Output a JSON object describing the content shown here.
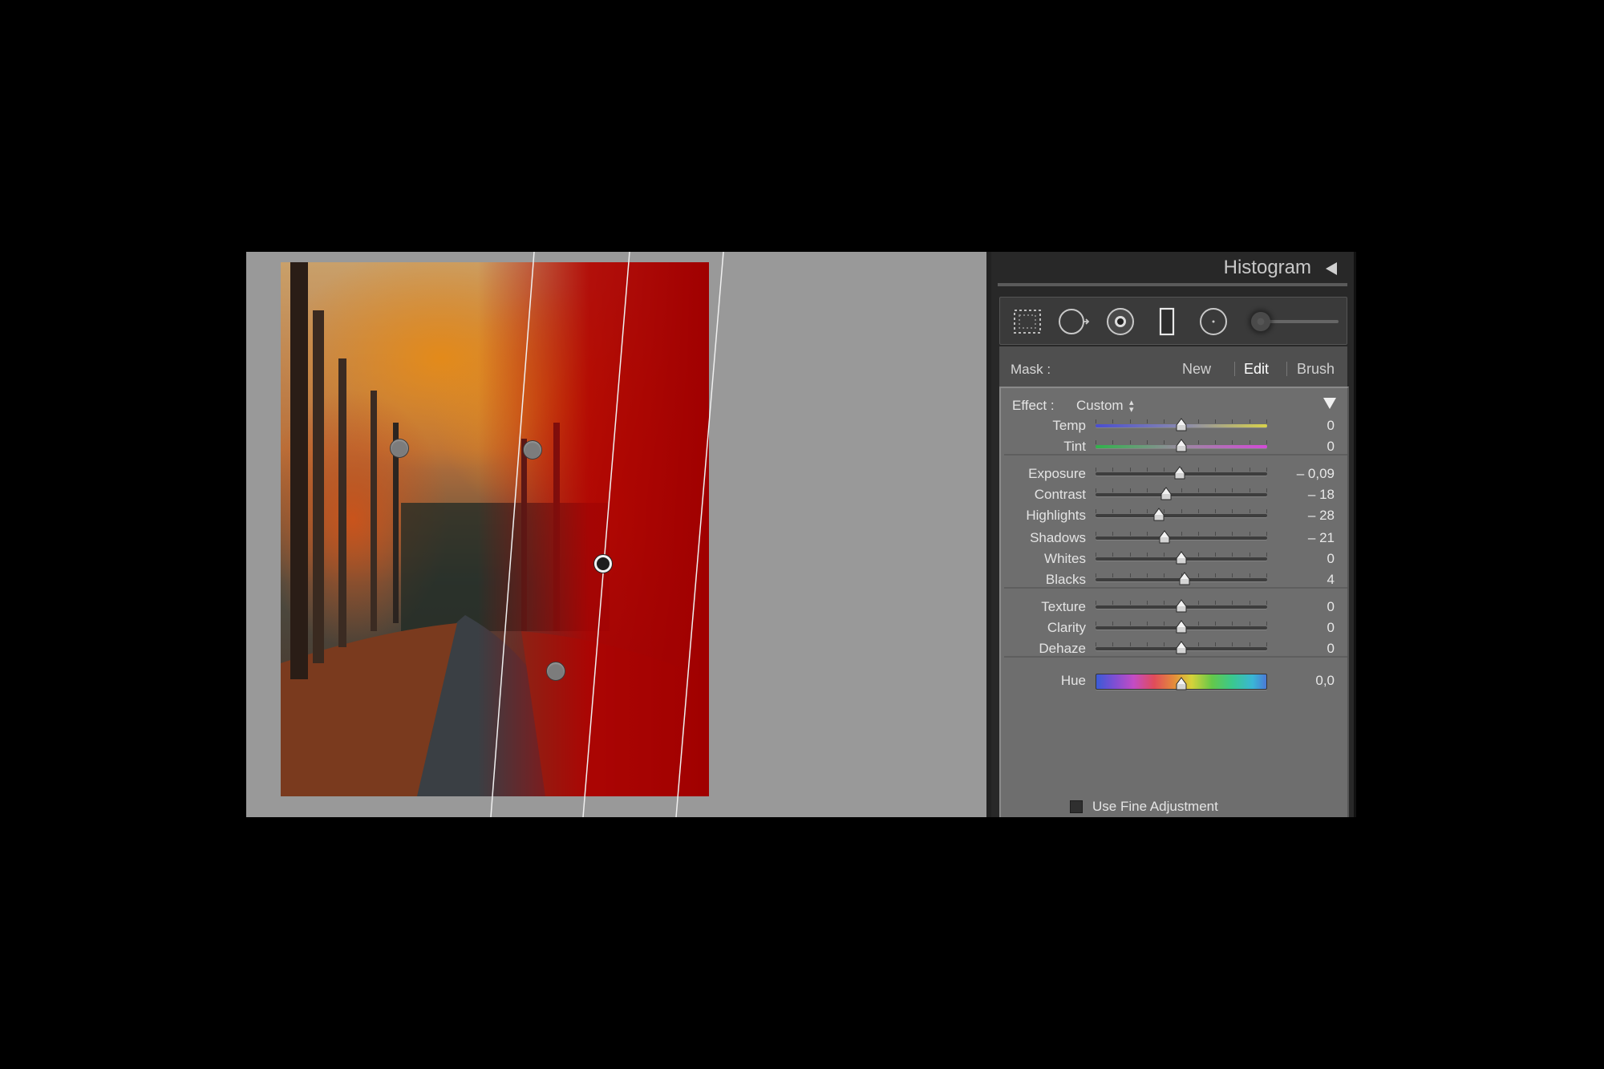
{
  "histogram": {
    "title": "Histogram"
  },
  "tools": [
    {
      "name": "range-mask-tool-icon"
    },
    {
      "name": "spot-removal-tool-icon"
    },
    {
      "name": "red-eye-tool-icon"
    },
    {
      "name": "graduated-filter-tool-icon"
    },
    {
      "name": "radial-filter-tool-icon"
    }
  ],
  "mask": {
    "label": "Mask :",
    "options": [
      {
        "label": "New",
        "active": false
      },
      {
        "label": "Edit",
        "active": true
      },
      {
        "label": "Brush",
        "active": false
      }
    ]
  },
  "effect": {
    "label": "Effect :",
    "preset": "Custom",
    "adjustments": [
      {
        "name": "temp",
        "label": "Temp",
        "value": "0",
        "position": 0.5,
        "track": "temp"
      },
      {
        "name": "tint",
        "label": "Tint",
        "value": "0",
        "position": 0.5,
        "track": "tint"
      },
      {
        "name": "exposure",
        "label": "Exposure",
        "value": "– 0,09",
        "position": 0.49,
        "track": "plain"
      },
      {
        "name": "contrast",
        "label": "Contrast",
        "value": "– 18",
        "position": 0.41,
        "track": "plain"
      },
      {
        "name": "highlights",
        "label": "Highlights",
        "value": "– 28",
        "position": 0.37,
        "track": "plain"
      },
      {
        "name": "shadows",
        "label": "Shadows",
        "value": "– 21",
        "position": 0.4,
        "track": "plain"
      },
      {
        "name": "whites",
        "label": "Whites",
        "value": "0",
        "position": 0.5,
        "track": "plain"
      },
      {
        "name": "blacks",
        "label": "Blacks",
        "value": "4",
        "position": 0.52,
        "track": "plain"
      },
      {
        "name": "texture",
        "label": "Texture",
        "value": "0",
        "position": 0.5,
        "track": "plain"
      },
      {
        "name": "clarity",
        "label": "Clarity",
        "value": "0",
        "position": 0.5,
        "track": "plain"
      },
      {
        "name": "dehaze",
        "label": "Dehaze",
        "value": "0",
        "position": 0.5,
        "track": "plain"
      },
      {
        "name": "hue",
        "label": "Hue",
        "value": "0,0",
        "position": 0.5,
        "track": "hue"
      }
    ],
    "fine_adjustment": {
      "label": "Use Fine Adjustment",
      "checked": false
    }
  },
  "colors": {
    "mask_overlay": "#b00000",
    "panel_bg": "#6e6e6e",
    "viewer_bg": "#999999"
  }
}
